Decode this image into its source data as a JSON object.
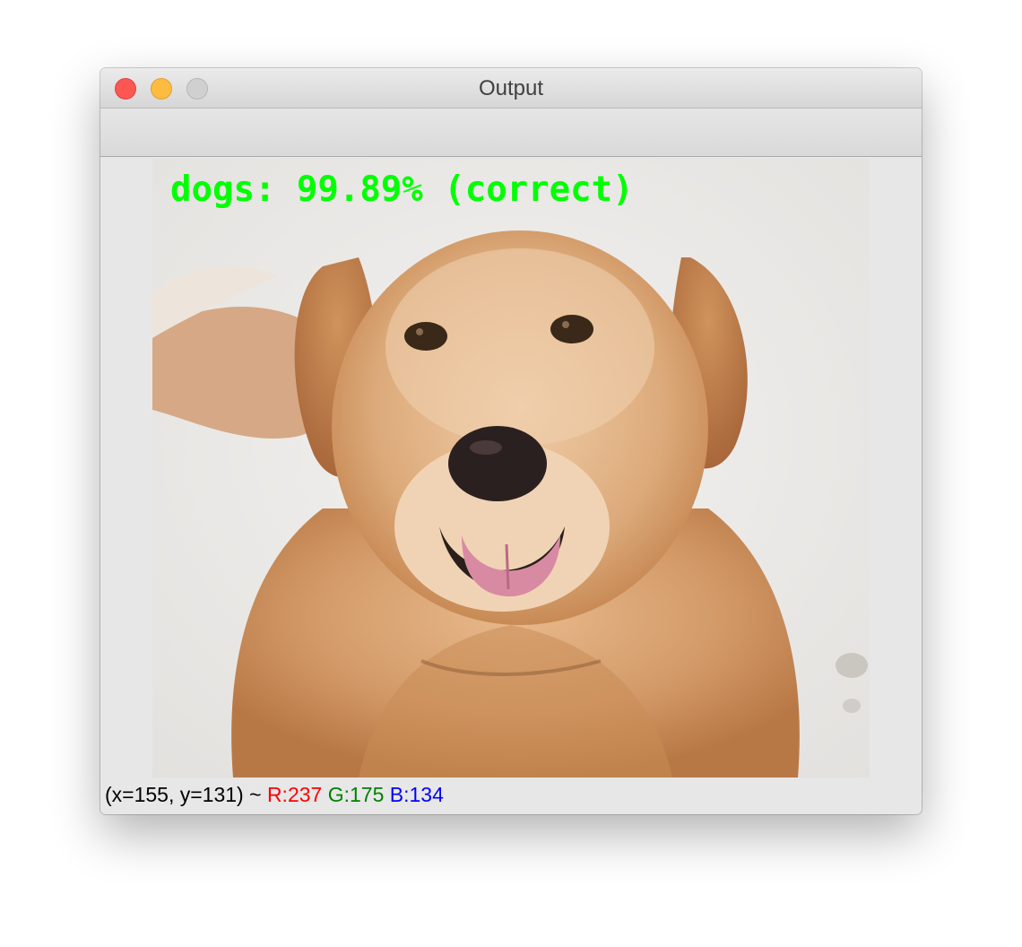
{
  "window": {
    "title": "Output"
  },
  "overlay": {
    "text": "dogs: 99.89% (correct)",
    "color": "#00ff00"
  },
  "status": {
    "coords": "(x=155, y=131) ~",
    "r": "R:237",
    "g": "G:175",
    "b": "B:134",
    "colors": {
      "r": "#ff0000",
      "g": "#008000",
      "b": "#0000ff"
    }
  },
  "colors": {
    "window_bg": "#e7e7e7",
    "close": "#fc5753",
    "minimize": "#fdbc40",
    "zoom": "#d0d0d0"
  }
}
